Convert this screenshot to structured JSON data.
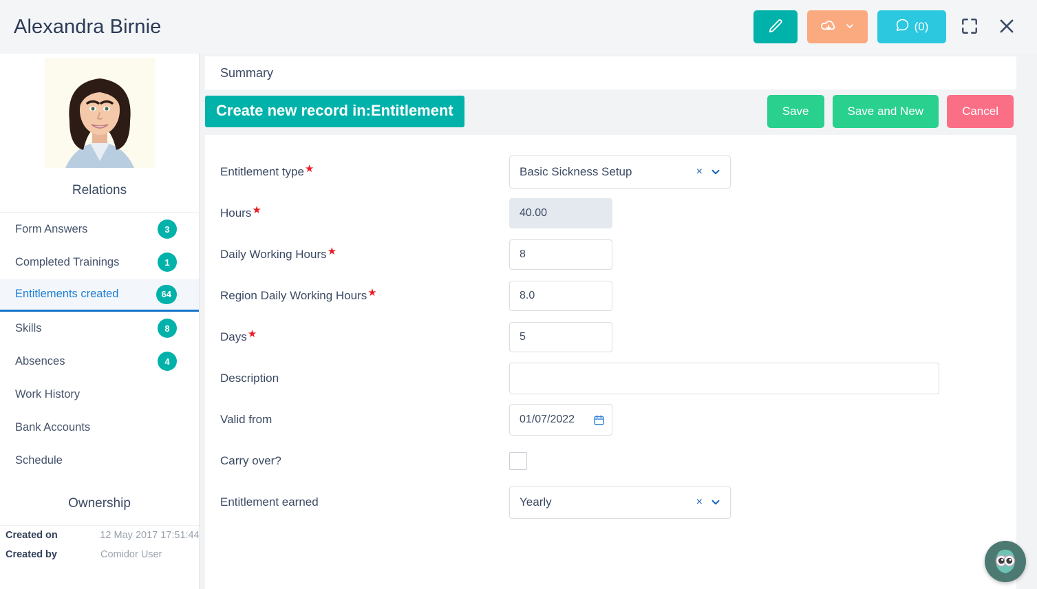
{
  "header": {
    "record_title": "Alexandra Birnie",
    "edit_icon": "pencil-icon",
    "export_icon": "cloud-download-icon",
    "export_chevron_icon": "chevron-down-icon",
    "chat_icon": "comment-icon",
    "chat_count": "(0)",
    "fullscreen_icon": "fullscreen-icon",
    "close_icon": "close-icon"
  },
  "sidebar": {
    "avatar_name": "avatar",
    "relations_title": "Relations",
    "items": [
      {
        "label": "Form Answers",
        "badge": "3"
      },
      {
        "label": "Completed Trainings",
        "badge": "1"
      },
      {
        "label": "Entitlements created",
        "badge": "64"
      },
      {
        "label": "Skills",
        "badge": "8"
      },
      {
        "label": "Absences",
        "badge": "4"
      },
      {
        "label": "Work History",
        "badge": ""
      },
      {
        "label": "Bank Accounts",
        "badge": ""
      },
      {
        "label": "Schedule",
        "badge": ""
      }
    ],
    "ownership": {
      "title": "Ownership",
      "created_on_label": "Created on",
      "created_on_value": "12 May 2017 17:51:44",
      "created_by_label": "Created by",
      "created_by_value": "Comidor User"
    }
  },
  "main": {
    "summary_tab": "Summary",
    "banner": "Create new record in:Entitlement",
    "actions": {
      "save": "Save",
      "save_and_new": "Save and New",
      "cancel": "Cancel"
    },
    "form": {
      "entitlement_type": {
        "label": "Entitlement type",
        "required": "★",
        "value": "Basic Sickness Setup",
        "clear": "×"
      },
      "hours": {
        "label": "Hours",
        "required": "★",
        "value": "40.00"
      },
      "daily_working_hours": {
        "label": "Daily Working Hours",
        "required": "★",
        "value": "8"
      },
      "region_daily_working_hours": {
        "label": "Region Daily Working Hours",
        "required": "★",
        "value": "8.0"
      },
      "days": {
        "label": "Days",
        "required": "★",
        "value": "5"
      },
      "description": {
        "label": "Description",
        "value": ""
      },
      "valid_from": {
        "label": "Valid from",
        "value": "01/07/2022",
        "icon": "calendar-icon"
      },
      "carry_over": {
        "label": "Carry over?",
        "checked": false
      },
      "entitlement_earned": {
        "label": "Entitlement earned",
        "value": "Yearly",
        "clear": "×"
      }
    }
  },
  "chat_widget": {
    "icon": "owl-mascot-icon"
  },
  "colors": {
    "teal": "#00b2a9",
    "green": "#2ad08e",
    "pink": "#fb6f86",
    "orange": "#fba97e",
    "cyan": "#2bc8e0",
    "blue_active": "#1e7fd4",
    "required_red": "#ec1c24"
  }
}
